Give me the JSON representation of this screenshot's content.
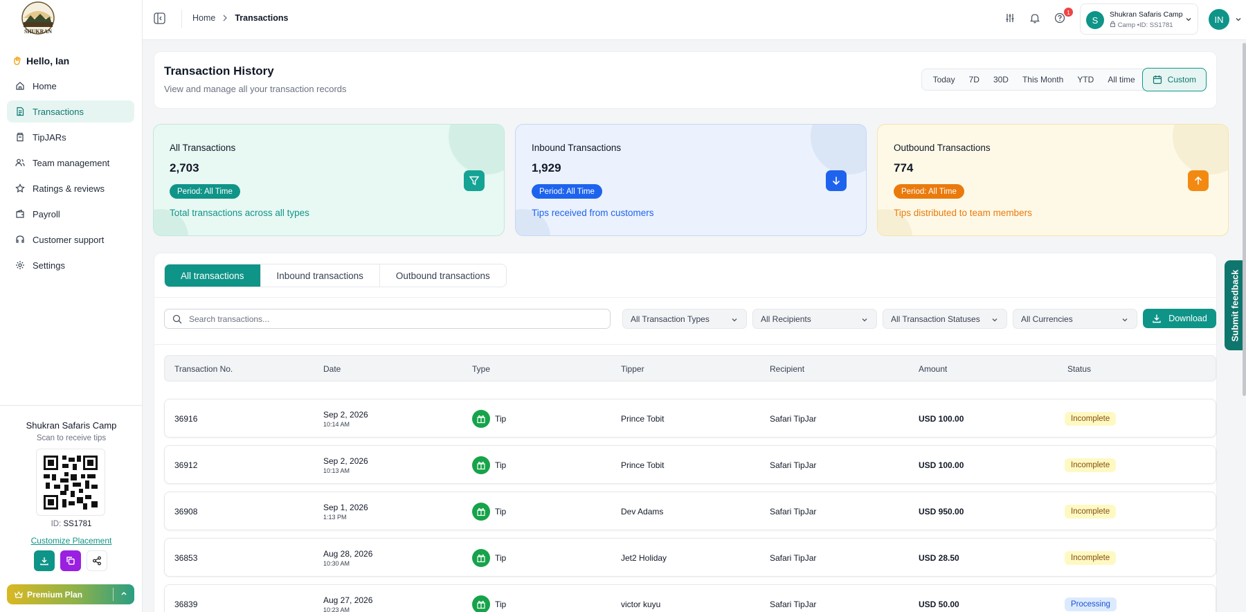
{
  "sidebar": {
    "greeting": "Hello, Ian",
    "logo_text": "SHUKRAN",
    "nav": [
      {
        "label": "Home",
        "icon": "home-icon"
      },
      {
        "label": "Transactions",
        "icon": "document-icon",
        "active": true
      },
      {
        "label": "TipJARs",
        "icon": "jar-icon"
      },
      {
        "label": "Team management",
        "icon": "users-icon"
      },
      {
        "label": "Ratings & reviews",
        "icon": "star-icon"
      },
      {
        "label": "Payroll",
        "icon": "wallet-icon"
      },
      {
        "label": "Customer support",
        "icon": "headset-icon"
      },
      {
        "label": "Settings",
        "icon": "gear-icon"
      }
    ],
    "camp_name": "Shukran Safaris Camp",
    "scan_text": "Scan to receive tips",
    "id_label": "ID:",
    "id_value": "SS1781",
    "customize_label": "Customize Placement",
    "premium_label": "Premium Plan"
  },
  "header": {
    "breadcrumb": [
      "Home",
      "Transactions"
    ],
    "notification_count": "1",
    "camp_switch": {
      "avatar": "S",
      "name": "Shukran Safaris Camp",
      "type": "Camp",
      "id": "ID: SS1781"
    },
    "user_initials": "IN"
  },
  "page": {
    "title": "Transaction History",
    "subtitle": "View and manage all your transaction records",
    "periods": [
      "Today",
      "7D",
      "30D",
      "This Month",
      "YTD",
      "All time"
    ],
    "custom_label": "Custom"
  },
  "stats": [
    {
      "label": "All Transactions",
      "value": "2,703",
      "period": "Period: All Time",
      "desc": "Total transactions across all types",
      "accent": "#0f9488",
      "icon": "filter-icon"
    },
    {
      "label": "Inbound Transactions",
      "value": "1,929",
      "period": "Period: All Time",
      "desc": "Tips received from customers",
      "accent": "#1d63ed",
      "icon": "arrow-down-icon"
    },
    {
      "label": "Outbound Transactions",
      "value": "774",
      "period": "Period: All Time",
      "desc": "Tips distributed to team members",
      "accent": "#ea7a0c",
      "icon": "arrow-up-icon"
    }
  ],
  "tabs": [
    "All transactions",
    "Inbound transactions",
    "Outbound transactions"
  ],
  "filters": {
    "search_placeholder": "Search transactions...",
    "selects": [
      "All Transaction Types",
      "All Recipients",
      "All Transaction Statuses",
      "All Currencies"
    ],
    "download_label": "Download"
  },
  "table": {
    "columns": [
      "Transaction No.",
      "Date",
      "Type",
      "Tipper",
      "Recipient",
      "Amount",
      "Status"
    ],
    "rows": [
      {
        "no": "36916",
        "date": "Sep 2, 2026",
        "time": "10:14 AM",
        "type": "Tip",
        "tipper": "Prince Tobit",
        "recipient": "Safari TipJar",
        "amount": "USD 100.00",
        "status": "Incomplete"
      },
      {
        "no": "36912",
        "date": "Sep 2, 2026",
        "time": "10:13 AM",
        "type": "Tip",
        "tipper": "Prince Tobit",
        "recipient": "Safari TipJar",
        "amount": "USD 100.00",
        "status": "Incomplete"
      },
      {
        "no": "36908",
        "date": "Sep 1, 2026",
        "time": "1:13 PM",
        "type": "Tip",
        "tipper": "Dev Adams",
        "recipient": "Safari TipJar",
        "amount": "USD 950.00",
        "status": "Incomplete"
      },
      {
        "no": "36853",
        "date": "Aug 28, 2026",
        "time": "10:30 AM",
        "type": "Tip",
        "tipper": "Jet2 Holiday",
        "recipient": "Safari TipJar",
        "amount": "USD 28.50",
        "status": "Incomplete"
      },
      {
        "no": "36839",
        "date": "Aug 27, 2026",
        "time": "10:23 AM",
        "type": "Tip",
        "tipper": "victor kuyu",
        "recipient": "Safari TipJar",
        "amount": "USD 50.00",
        "status": "Processing"
      }
    ]
  },
  "feedback_label": "Submit feedback"
}
